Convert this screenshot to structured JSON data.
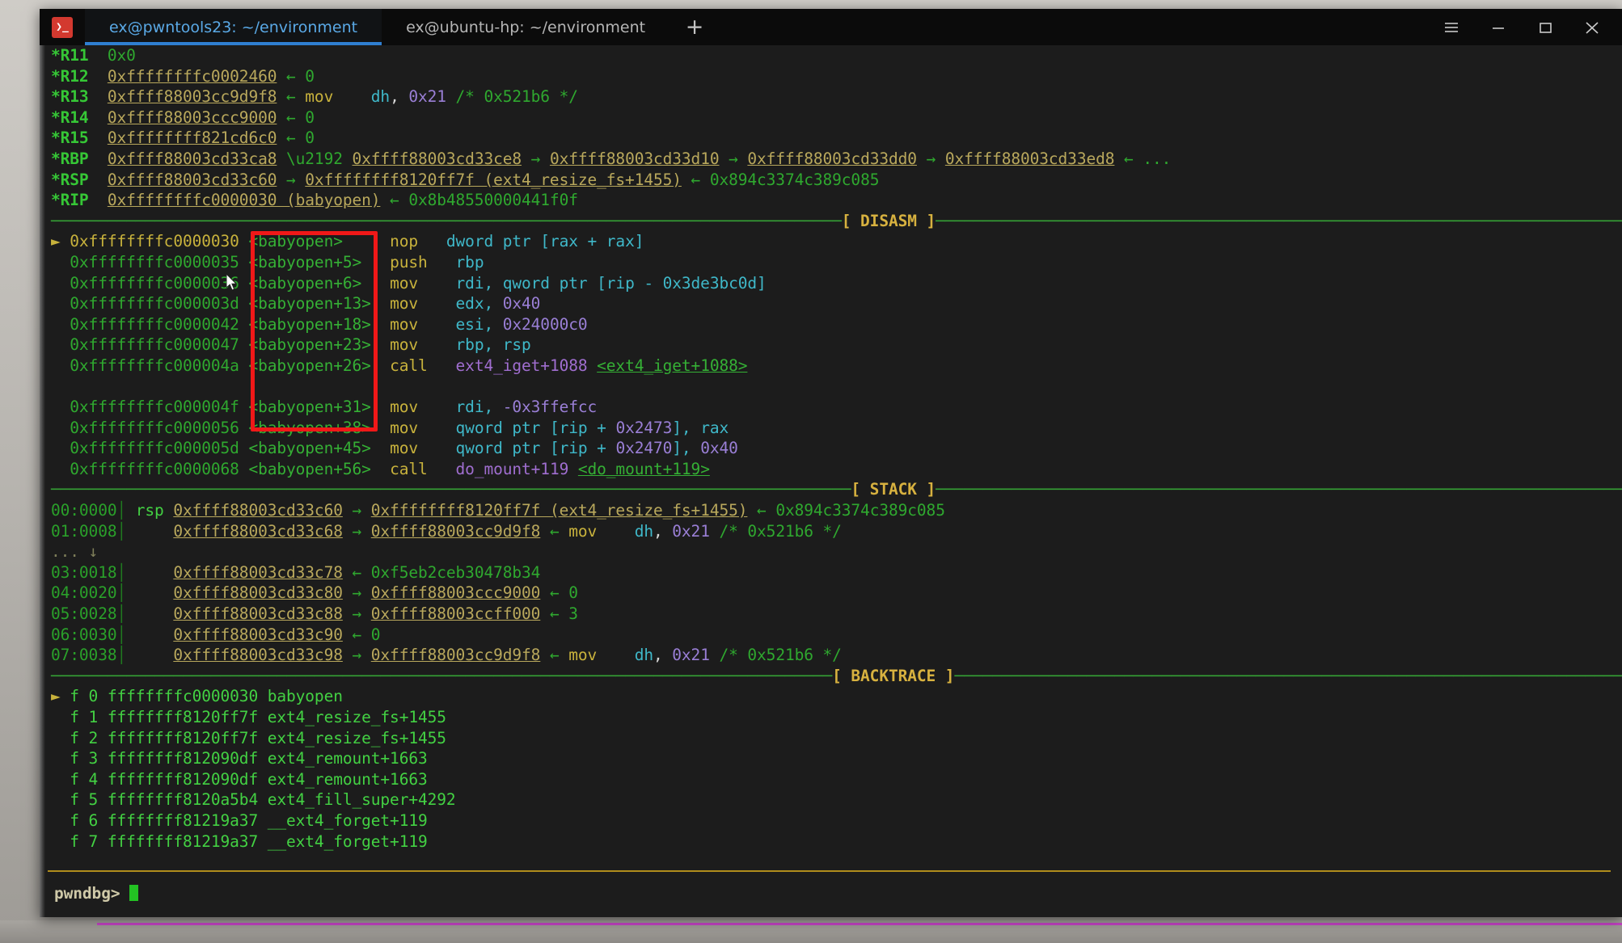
{
  "window": {
    "app_icon_glyph": "❯_",
    "tabs": [
      {
        "label": "ex@pwntools23: ~/environment",
        "active": true
      },
      {
        "label": "ex@ubuntu-hp: ~/environment",
        "active": false
      }
    ],
    "new_tab_label": "+",
    "controls": {
      "menu": "hamburger-menu",
      "minimize": "minimize",
      "maximize": "maximize",
      "close": "close"
    }
  },
  "registers": [
    {
      "name": "*R11",
      "value": "0x0",
      "chain": []
    },
    {
      "name": "*R12",
      "value": "0xffffffffc0002460",
      "arrow": "←",
      "tail": "0"
    },
    {
      "name": "*R13",
      "value": "0xffff88003cc9d9f8",
      "arrow": "←",
      "tail": "mov    dh, 0x21 /* 0x521b6 */"
    },
    {
      "name": "*R14",
      "value": "0xffff88003ccc9000",
      "arrow": "←",
      "tail": "0"
    },
    {
      "name": "*R15",
      "value": "0xffffffff821cd6c0",
      "arrow": "←",
      "tail": "0"
    },
    {
      "name": "*RBP",
      "value": "0xffff88003cd33ca8",
      "arrow": "→",
      "tail": "0xffff88003cd33ce8 → 0xffff88003cd33d10 → 0xffff88003cd33dd0 → 0xffff88003cd33ed8 ← ..."
    },
    {
      "name": "*RSP",
      "value": "0xffff88003cd33c60",
      "arrow": "→",
      "tail": "0xffffffff8120ff7f (ext4_resize_fs+1455) ← 0x894c3374c389c085"
    },
    {
      "name": "*RIP",
      "value": "0xffffffffc0000030 (babyopen)",
      "arrow": "←",
      "tail": "0x8b48550000441f0f"
    }
  ],
  "sections": {
    "disasm_banner": "[ DISASM ]",
    "stack_banner": "[ STACK ]",
    "backtrace_banner": "[ BACKTRACE ]"
  },
  "disasm": [
    {
      "marker": "►",
      "addr": "0xffffffffc0000030",
      "sym": "<babyopen>",
      "mnemonic": "nop",
      "operands": "dword ptr [rax + rax]",
      "current": true
    },
    {
      "marker": "",
      "addr": "0xffffffffc0000035",
      "sym": "<babyopen+5>",
      "mnemonic": "push",
      "operands": "rbp"
    },
    {
      "marker": "",
      "addr": "0xffffffffc0000036",
      "sym": "<babyopen+6>",
      "mnemonic": "mov",
      "operands": "rdi, qword ptr [rip - 0x3de3bc0d]"
    },
    {
      "marker": "",
      "addr": "0xffffffffc000003d",
      "sym": "<babyopen+13>",
      "mnemonic": "mov",
      "operands": "edx, 0x40"
    },
    {
      "marker": "",
      "addr": "0xffffffffc0000042",
      "sym": "<babyopen+18>",
      "mnemonic": "mov",
      "operands": "esi, 0x24000c0"
    },
    {
      "marker": "",
      "addr": "0xffffffffc0000047",
      "sym": "<babyopen+23>",
      "mnemonic": "mov",
      "operands": "rbp, rsp"
    },
    {
      "marker": "",
      "addr": "0xffffffffc000004a",
      "sym": "<babyopen+26>",
      "mnemonic": "call",
      "operands": "ext4_iget+1088 <ext4_iget+1088>",
      "call": true
    },
    {
      "gap": true
    },
    {
      "marker": "",
      "addr": "0xffffffffc000004f",
      "sym": "<babyopen+31>",
      "mnemonic": "mov",
      "operands": "rdi, -0x3ffefcc"
    },
    {
      "marker": "",
      "addr": "0xffffffffc0000056",
      "sym": "<babyopen+38>",
      "mnemonic": "mov",
      "operands": "qword ptr [rip + 0x2473], rax"
    },
    {
      "marker": "",
      "addr": "0xffffffffc000005d",
      "sym": "<babyopen+45>",
      "mnemonic": "mov",
      "operands": "qword ptr [rip + 0x2470], 0x40"
    },
    {
      "marker": "",
      "addr": "0xffffffffc0000068",
      "sym": "<babyopen+56>",
      "mnemonic": "call",
      "operands": "do_mount+119 <do_mount+119>",
      "call": true
    }
  ],
  "stack": [
    {
      "index": "00:0000",
      "reg": "rsp",
      "addr": "0xffff88003cd33c60",
      "arrow": "→",
      "tail": "0xffffffff8120ff7f (ext4_resize_fs+1455) ← 0x894c3374c389c085"
    },
    {
      "index": "01:0008",
      "reg": "",
      "addr": "0xffff88003cd33c68",
      "arrow": "→",
      "tail": "0xffff88003cc9d9f8 ← mov    dh, 0x21 /* 0x521b6 */"
    },
    {
      "ellipsis": "... ↓"
    },
    {
      "index": "03:0018",
      "reg": "",
      "addr": "0xffff88003cd33c78",
      "arrow": "←",
      "tail": "0xf5eb2ceb30478b34"
    },
    {
      "index": "04:0020",
      "reg": "",
      "addr": "0xffff88003cd33c80",
      "arrow": "→",
      "tail": "0xffff88003ccc9000 ← 0"
    },
    {
      "index": "05:0028",
      "reg": "",
      "addr": "0xffff88003cd33c88",
      "arrow": "→",
      "tail": "0xffff88003ccff000 ← 3"
    },
    {
      "index": "06:0030",
      "reg": "",
      "addr": "0xffff88003cd33c90",
      "arrow": "←",
      "tail": "0"
    },
    {
      "index": "07:0038",
      "reg": "",
      "addr": "0xffff88003cd33c98",
      "arrow": "→",
      "tail": "0xffff88003cc9d9f8 ← mov    dh, 0x21 /* 0x521b6 */"
    }
  ],
  "backtrace": [
    {
      "marker": "►",
      "frame": "f 0",
      "addr": "ffffffffc0000030",
      "sym": "babyopen"
    },
    {
      "marker": "",
      "frame": "f 1",
      "addr": "ffffffff8120ff7f",
      "sym": "ext4_resize_fs+1455"
    },
    {
      "marker": "",
      "frame": "f 2",
      "addr": "ffffffff8120ff7f",
      "sym": "ext4_resize_fs+1455"
    },
    {
      "marker": "",
      "frame": "f 3",
      "addr": "ffffffff812090df",
      "sym": "ext4_remount+1663"
    },
    {
      "marker": "",
      "frame": "f 4",
      "addr": "ffffffff812090df",
      "sym": "ext4_remount+1663"
    },
    {
      "marker": "",
      "frame": "f 5",
      "addr": "ffffffff8120a5b4",
      "sym": "ext4_fill_super+4292"
    },
    {
      "marker": "",
      "frame": "f 6",
      "addr": "ffffffff81219a37",
      "sym": "__ext4_forget+119"
    },
    {
      "marker": "",
      "frame": "f 7",
      "addr": "ffffffff81219a37",
      "sym": "__ext4_forget+119"
    }
  ],
  "prompt": {
    "text": "pwndbg>",
    "input": ""
  },
  "annotation": {
    "kind": "red-rectangle-highlight",
    "color": "#f01818"
  },
  "colors": {
    "background": "#1c1c1c",
    "titlebar": "#0b0b0b",
    "tab_active_text": "#5aa9e6",
    "banner": "#b08d1c",
    "register_name": "#36c736",
    "address": "#b9a85c",
    "symbol": "#35b035",
    "mnemonic": "#c8b23c",
    "operand_reg": "#3fb8c9",
    "immediate": "#9a7fd6",
    "highlight": "#f01818"
  }
}
